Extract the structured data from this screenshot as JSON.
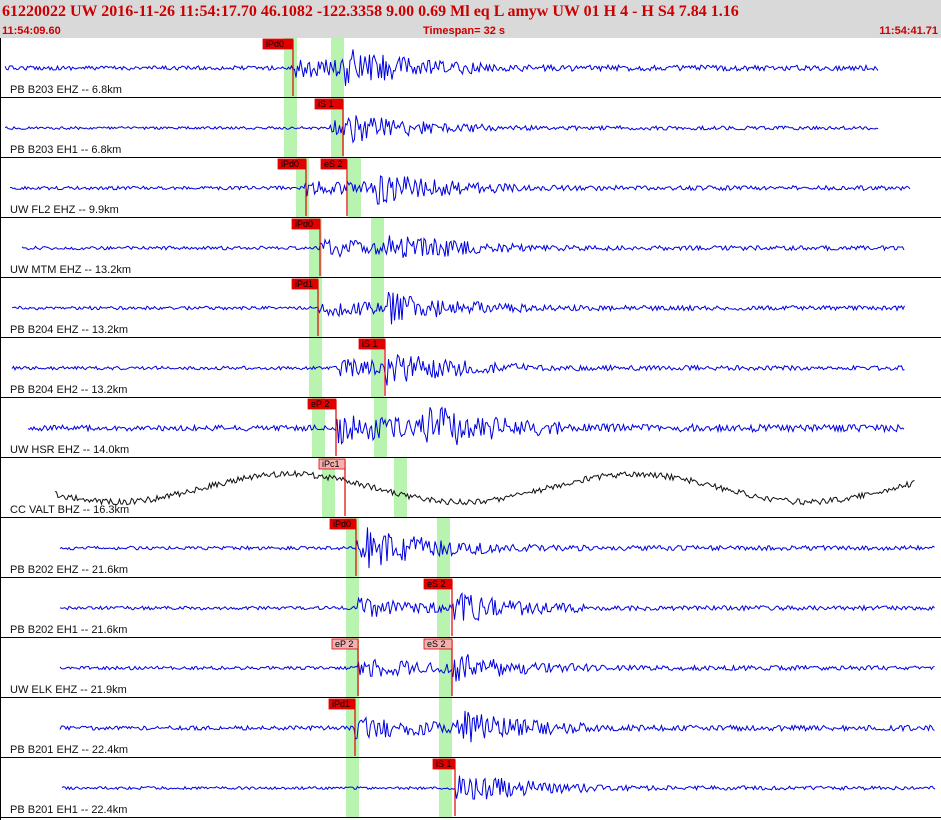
{
  "header": {
    "title": "61220022 UW 2016-11-26 11:54:17.70   46.1082 -122.3358   9.00  0.69 Ml  eq  L amyw     UW 01  H   4  -  H S4    7.84  1.16",
    "start_time": "11:54:09.60",
    "timespan": "Timespan=  32 s",
    "end_time": "11:54:41.71"
  },
  "colors": {
    "trace": "#0000e0",
    "trace_alt": "#111111",
    "pick": "#e00000",
    "pick_light": "#f4b0b0",
    "window": "#b8f4b0"
  },
  "seismograms": [
    {
      "label": "PB B203 EHZ -- 6.8km",
      "color": "#0000e0",
      "amp": 6,
      "picks": [
        {
          "text": "iPd0",
          "style": "solid"
        }
      ]
    },
    {
      "label": "PB B203 EH1 -- 6.8km",
      "color": "#0000e0",
      "amp": 4,
      "picks": [
        {
          "text": "iS 1",
          "style": "solid"
        }
      ]
    },
    {
      "label": "UW FL2 EHZ -- 9.9km",
      "color": "#0000e0",
      "amp": 5,
      "picks": [
        {
          "text": "iPd0",
          "style": "solid"
        },
        {
          "text": "eS 2",
          "style": "solid"
        }
      ]
    },
    {
      "label": "UW MTM EHZ -- 13.2km",
      "color": "#0000e0",
      "amp": 5,
      "picks": [
        {
          "text": "iPd0",
          "style": "solid"
        }
      ]
    },
    {
      "label": "PB B204 EHZ -- 13.2km",
      "color": "#0000e0",
      "amp": 5,
      "picks": [
        {
          "text": "iPd1",
          "style": "solid"
        }
      ]
    },
    {
      "label": "PB B204 EH2 -- 13.2km",
      "color": "#0000e0",
      "amp": 5,
      "picks": [
        {
          "text": "iS 1",
          "style": "solid"
        }
      ]
    },
    {
      "label": "UW HSR EHZ -- 14.0km",
      "color": "#0000e0",
      "amp": 8,
      "picks": [
        {
          "text": "eP 2",
          "style": "solid"
        }
      ]
    },
    {
      "label": "CC VALT BHZ -- 16.3km",
      "color": "#111111",
      "amp": 8,
      "picks": [
        {
          "text": "iPc1",
          "style": "light"
        }
      ]
    },
    {
      "label": "PB B202 EHZ -- 21.6km",
      "color": "#0000e0",
      "amp": 5,
      "picks": [
        {
          "text": "iPd0",
          "style": "solid"
        }
      ]
    },
    {
      "label": "PB B202 EH1 -- 21.6km",
      "color": "#0000e0",
      "amp": 5,
      "picks": [
        {
          "text": "eS 2",
          "style": "solid"
        }
      ]
    },
    {
      "label": "UW ELK EHZ -- 21.9km",
      "color": "#0000e0",
      "amp": 5,
      "picks": [
        {
          "text": "eP 2",
          "style": "light"
        },
        {
          "text": "eS 2",
          "style": "light"
        }
      ]
    },
    {
      "label": "PB B201 EHZ -- 22.4km",
      "color": "#0000e0",
      "amp": 6,
      "picks": [
        {
          "text": "iPd1",
          "style": "solid"
        }
      ]
    },
    {
      "label": "PB B201 EH1 -- 22.4km",
      "color": "#0000e0",
      "amp": 4,
      "picks": [
        {
          "text": "iS 1",
          "style": "solid"
        }
      ]
    }
  ]
}
